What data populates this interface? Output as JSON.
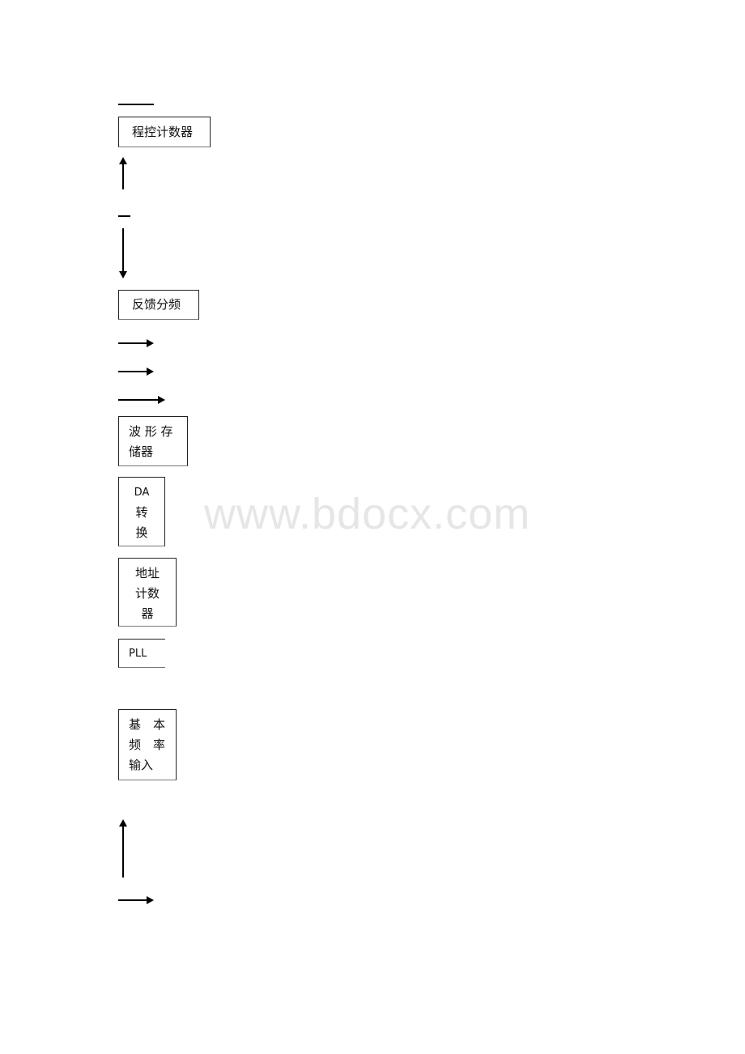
{
  "watermark": "www.bdocx.com",
  "blocks": {
    "program_counter": "程控计数器",
    "feedback_divider": "反馈分频",
    "waveform_memory": [
      "波 形 存",
      "储器"
    ],
    "da_converter": [
      "DA",
      "转",
      "换"
    ],
    "address_counter": [
      "地址",
      "计数",
      "器"
    ],
    "pll": "PLL",
    "base_freq_input": [
      "基　本",
      "频　率",
      "输入"
    ]
  }
}
